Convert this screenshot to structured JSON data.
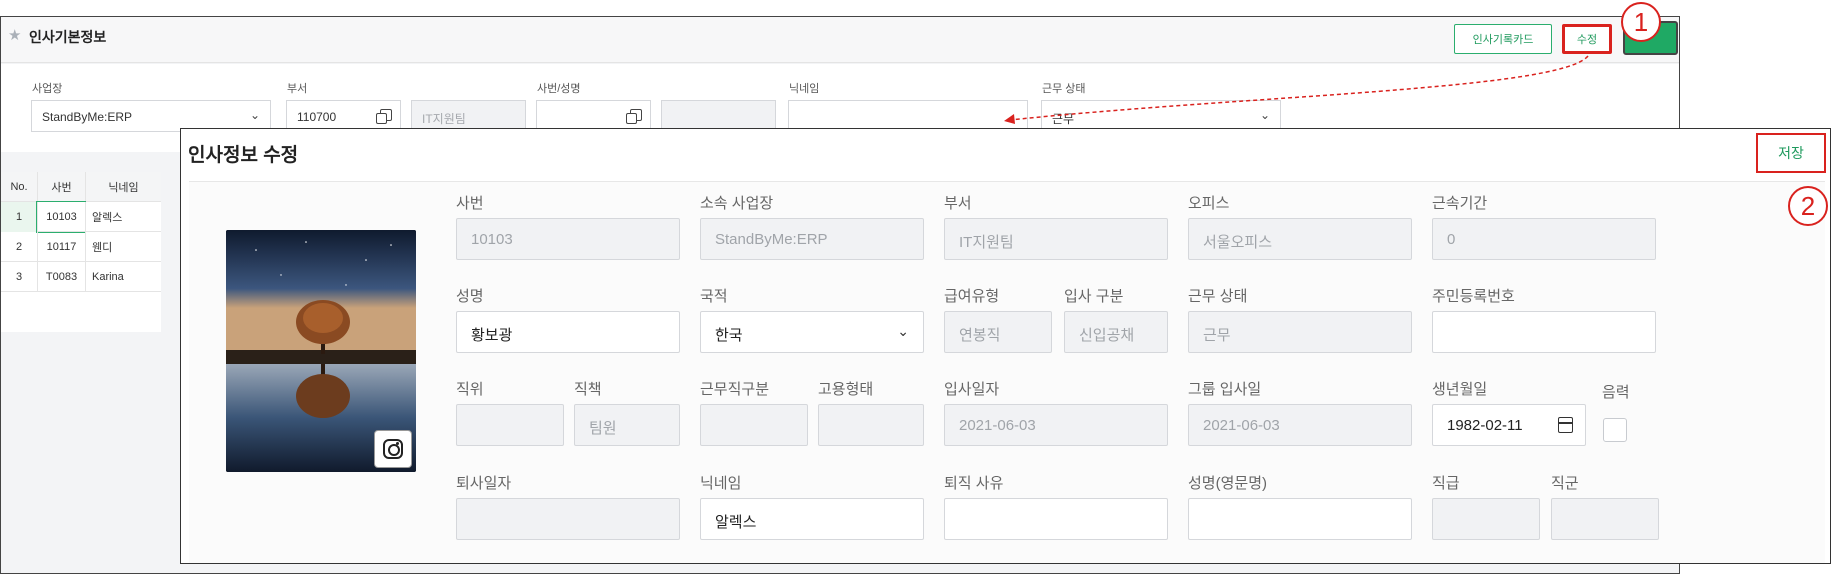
{
  "background": {
    "title": "인사기본정보",
    "buttons": {
      "card": "인사기록카드",
      "edit": "수정"
    },
    "filters": {
      "site_label": "사업장",
      "site_value": "StandByMe:ERP",
      "dept_label": "부서",
      "dept_code": "110700",
      "dept_name": "IT지원팀",
      "emp_label": "사번/성명",
      "nickname_label": "닉네임",
      "status_label": "근무 상태",
      "status_value": "근무"
    },
    "table": {
      "headers": [
        "No.",
        "사번",
        "닉네임"
      ],
      "rows": [
        [
          "1",
          "10103",
          "알렉스"
        ],
        [
          "2",
          "10117",
          "웬디"
        ],
        [
          "3",
          "T0083",
          "Karina"
        ]
      ]
    }
  },
  "markers": {
    "one": "1",
    "two": "2"
  },
  "modal": {
    "title": "인사정보 수정",
    "save_label": "저장",
    "fields": {
      "emp_no": {
        "label": "사번",
        "value": "10103"
      },
      "site": {
        "label": "소속 사업장",
        "value": "StandByMe:ERP"
      },
      "dept": {
        "label": "부서",
        "value": "IT지원팀"
      },
      "office": {
        "label": "오피스",
        "value": "서울오피스"
      },
      "tenure": {
        "label": "근속기간",
        "value": "0"
      },
      "name": {
        "label": "성명",
        "value": "황보광"
      },
      "nationality": {
        "label": "국적",
        "value": "한국"
      },
      "pay_type": {
        "label": "급여유형",
        "value": "연봉직"
      },
      "join_type": {
        "label": "입사 구분",
        "value": "신입공채"
      },
      "work_status": {
        "label": "근무 상태",
        "value": "근무"
      },
      "resident_no": {
        "label": "주민등록번호",
        "value": ""
      },
      "position": {
        "label": "직위",
        "value": ""
      },
      "duty": {
        "label": "직책",
        "value": "팀원"
      },
      "work_class": {
        "label": "근무직구분",
        "value": ""
      },
      "employ_type": {
        "label": "고용형태",
        "value": ""
      },
      "join_date": {
        "label": "입사일자",
        "value": "2021-06-03"
      },
      "group_join_date": {
        "label": "그룹 입사일",
        "value": "2021-06-03"
      },
      "birth_date": {
        "label": "생년월일",
        "value": "1982-02-11"
      },
      "lunar": {
        "label": "음력"
      },
      "leave_date": {
        "label": "퇴사일자",
        "value": ""
      },
      "nickname": {
        "label": "닉네임",
        "value": "알렉스"
      },
      "leave_reason": {
        "label": "퇴직 사유",
        "value": ""
      },
      "eng_name": {
        "label": "성명(영문명)",
        "value": ""
      },
      "grade": {
        "label": "직급",
        "value": ""
      },
      "job_group": {
        "label": "직군",
        "value": ""
      }
    }
  },
  "icons": [
    "star-icon",
    "chevron-down-icon",
    "copy-icon",
    "instagram-icon",
    "calendar-icon"
  ],
  "colors": {
    "accent_green": "#1fa964",
    "marker_red": "#d9221e"
  }
}
